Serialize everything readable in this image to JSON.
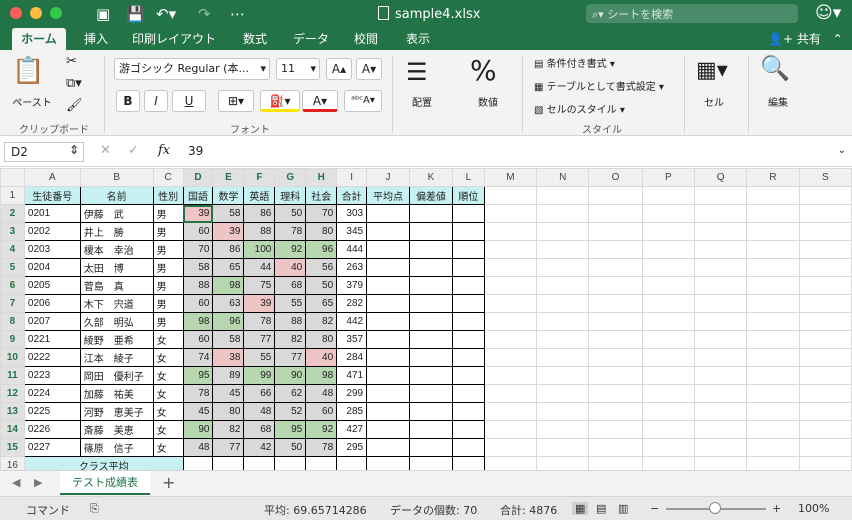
{
  "window": {
    "title": "sample4.xlsx",
    "search_placeholder": "シートを検索"
  },
  "ribbon_tabs": [
    "ホーム",
    "挿入",
    "印刷レイアウト",
    "数式",
    "データ",
    "校閲",
    "表示"
  ],
  "share_label": "共有",
  "ribbon": {
    "paste_label": "ペースト",
    "clipboard_group": "クリップボード",
    "font_name": "游ゴシック Regular (本...",
    "font_size": "11",
    "bold": "B",
    "italic": "I",
    "underline": "U",
    "font_group": "フォント",
    "align_label": "配置",
    "number_label": "数値",
    "cond_format": "条件付き書式",
    "table_format": "テーブルとして書式設定",
    "cell_style": "セルのスタイル",
    "style_group": "スタイル",
    "cell_label": "セル",
    "edit_label": "編集"
  },
  "formula_bar": {
    "name_box": "D2",
    "fx": "fx",
    "value": "39"
  },
  "columns": [
    "A",
    "B",
    "C",
    "D",
    "E",
    "F",
    "G",
    "H",
    "I",
    "J",
    "K",
    "L",
    "M",
    "N",
    "O",
    "P",
    "Q",
    "R",
    "S"
  ],
  "header_row": [
    "生徒番号",
    "名前",
    "性別",
    "国語",
    "数学",
    "英語",
    "理科",
    "社会",
    "合計",
    "平均点",
    "偏差値",
    "順位"
  ],
  "rows": [
    [
      "0201",
      "伊藤　武",
      "男",
      "39",
      "58",
      "86",
      "50",
      "70",
      "303"
    ],
    [
      "0202",
      "井上　勝",
      "男",
      "60",
      "39",
      "88",
      "78",
      "80",
      "345"
    ],
    [
      "0203",
      "榎本　幸治",
      "男",
      "70",
      "86",
      "100",
      "92",
      "96",
      "444"
    ],
    [
      "0204",
      "太田　博",
      "男",
      "58",
      "65",
      "44",
      "40",
      "56",
      "263"
    ],
    [
      "0205",
      "菅島　真",
      "男",
      "88",
      "98",
      "75",
      "68",
      "50",
      "379"
    ],
    [
      "0206",
      "木下　宍道",
      "男",
      "60",
      "63",
      "39",
      "55",
      "65",
      "282"
    ],
    [
      "0207",
      "久部　明弘",
      "男",
      "98",
      "96",
      "78",
      "88",
      "82",
      "442"
    ],
    [
      "0221",
      "綾野　亜希",
      "女",
      "60",
      "58",
      "77",
      "82",
      "80",
      "357"
    ],
    [
      "0222",
      "江本　綾子",
      "女",
      "74",
      "38",
      "55",
      "77",
      "40",
      "284"
    ],
    [
      "0223",
      "岡田　優利子",
      "女",
      "95",
      "89",
      "99",
      "90",
      "98",
      "471"
    ],
    [
      "0224",
      "加藤　祐美",
      "女",
      "78",
      "45",
      "66",
      "62",
      "48",
      "299"
    ],
    [
      "0225",
      "河野　恵美子",
      "女",
      "45",
      "80",
      "48",
      "52",
      "60",
      "285"
    ],
    [
      "0226",
      "斎藤　美恵",
      "女",
      "90",
      "82",
      "68",
      "95",
      "92",
      "427"
    ],
    [
      "0227",
      "篠原　信子",
      "女",
      "48",
      "77",
      "42",
      "50",
      "78",
      "295"
    ]
  ],
  "row16_label": "クラス平均",
  "sheet_tab": "テスト成績表",
  "status": {
    "mode": "コマンド",
    "average": "平均: 69.65714286",
    "count": "データの個数: 70",
    "sum": "合計: 4876",
    "zoom": "100%"
  }
}
